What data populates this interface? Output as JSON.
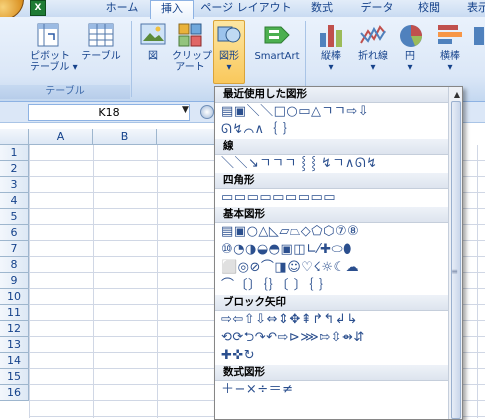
{
  "ribbon": {
    "tabs": [
      "ホーム",
      "挿入",
      "ページ レイアウト",
      "数式",
      "データ",
      "校閲",
      "表示"
    ],
    "active_tab": "挿入",
    "qat_icon": "excel-icon",
    "buttons": {
      "pivot_table": "ピボット\nテーブル ▾",
      "table": "テーブル",
      "picture": "図",
      "clipart": "クリップ\nアート",
      "shapes": "図形\n▾",
      "smartart": "SmartArt",
      "column": "縦棒\n▾",
      "line": "折れ線\n▾",
      "pie": "円\n▾",
      "bar": "横棒\n▾"
    },
    "group_table": "テーブル"
  },
  "formula_bar": {
    "name_box": "K18"
  },
  "grid": {
    "columns": [
      "A",
      "B"
    ],
    "rows": [
      "1",
      "2",
      "3",
      "4",
      "5",
      "6",
      "7",
      "8",
      "9",
      "10",
      "11",
      "12",
      "13",
      "14",
      "15",
      "16"
    ]
  },
  "shapes_menu": {
    "sections": [
      {
        "title": "最近使用した図形",
        "rows": [
          "▤▣＼＼□○▭△ㄱㄱ⇨⇩",
          "ᘏ↯⌒∧｛ ｝"
        ]
      },
      {
        "title": "線",
        "rows": [
          "＼＼↘ㄱㄱㄱ ⸾ ⸾ ↯ㄱ∧ᘏ↯"
        ]
      },
      {
        "title": "四角形",
        "rows": [
          "▭▭▭▭▭▭▭▭▭"
        ]
      },
      {
        "title": "基本図形",
        "rows": [
          "▤▣○△◺▱⏢◇⬠⬡⑦⑧",
          "⑩◔◑◒◓▣◫∟⁄✚⬭⬮",
          "⬜◎⊘⌒◨☺♡☇☼☾☁",
          "⌒〔〕｛｝〔 〕｛ ｝"
        ]
      },
      {
        "title": "ブロック矢印",
        "rows": [
          "⇨⇦⇧⇩⇔⇕✥⇞↱↰↲↳",
          "⟲⟳⮌↷↶⇨⊳⋙⇰⇳⇴⇵",
          "✚✜↻"
        ]
      },
      {
        "title": "数式図形",
        "rows": [
          "＋−×÷＝≠"
        ]
      }
    ],
    "scroll_up": "▲",
    "grip": "≡"
  }
}
